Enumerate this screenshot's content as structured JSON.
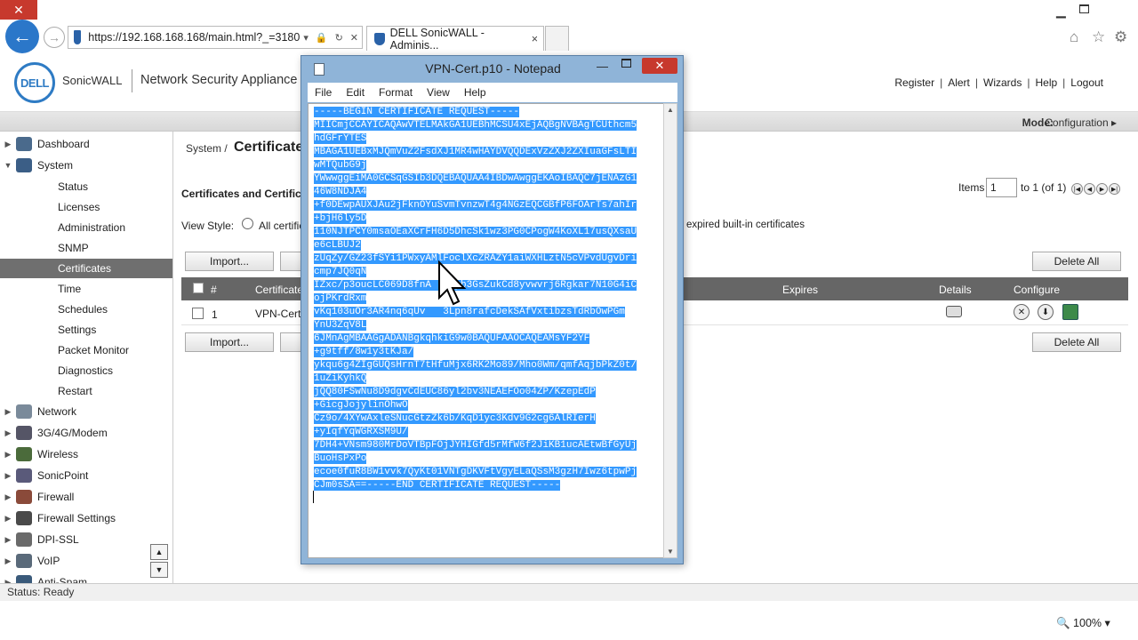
{
  "browser": {
    "url": "https://192.168.168.168/main.html?_=3180",
    "tab_title": "DELL SonicWALL - Adminis...",
    "tab_close": "×",
    "zoom": "100%"
  },
  "header": {
    "logo_text": "DELL",
    "brand": "SonicWALL",
    "product": "Network Security Appliance",
    "links": [
      "Register",
      "Alert",
      "Wizards",
      "Help",
      "Logout"
    ],
    "mode_label": "Mode:",
    "mode_value": "Configuration ▸"
  },
  "sidebar": {
    "items": [
      {
        "label": "Dashboard",
        "type": "top",
        "arrow": "▶"
      },
      {
        "label": "System",
        "type": "top",
        "arrow": "▼"
      },
      {
        "label": "Status",
        "type": "sub"
      },
      {
        "label": "Licenses",
        "type": "sub"
      },
      {
        "label": "Administration",
        "type": "sub"
      },
      {
        "label": "SNMP",
        "type": "sub"
      },
      {
        "label": "Certificates",
        "type": "sub",
        "active": true
      },
      {
        "label": "Time",
        "type": "sub"
      },
      {
        "label": "Schedules",
        "type": "sub"
      },
      {
        "label": "Settings",
        "type": "sub"
      },
      {
        "label": "Packet Monitor",
        "type": "sub"
      },
      {
        "label": "Diagnostics",
        "type": "sub"
      },
      {
        "label": "Restart",
        "type": "sub"
      },
      {
        "label": "Network",
        "type": "top",
        "arrow": "▶"
      },
      {
        "label": "3G/4G/Modem",
        "type": "top",
        "arrow": "▶"
      },
      {
        "label": "Wireless",
        "type": "top",
        "arrow": "▶"
      },
      {
        "label": "SonicPoint",
        "type": "top",
        "arrow": "▶"
      },
      {
        "label": "Firewall",
        "type": "top",
        "arrow": "▶"
      },
      {
        "label": "Firewall Settings",
        "type": "top",
        "arrow": "▶"
      },
      {
        "label": "DPI-SSL",
        "type": "top",
        "arrow": "▶"
      },
      {
        "label": "VoIP",
        "type": "top",
        "arrow": "▶"
      },
      {
        "label": "Anti-Spam",
        "type": "top",
        "arrow": "▶"
      }
    ]
  },
  "main": {
    "breadcrumb": "System /",
    "page_title": "Certificate",
    "section_title": "Certificates and Certifica",
    "view_style_label": "View Style:",
    "radio_all_label": "All certific",
    "expired_label": "expired built-in certificates",
    "items_label": "Items",
    "items_value": "1",
    "items_range": "to 1 (of 1)",
    "import_label": "Import...",
    "delete_all_label": "Delete All",
    "table": {
      "headers": {
        "num": "#",
        "cert": "Certificate",
        "expires": "Expires",
        "details": "Details",
        "configure": "Configure"
      },
      "rows": [
        {
          "num": "1",
          "name": "VPN-Cert"
        }
      ]
    }
  },
  "status": {
    "text": "Status: Ready"
  },
  "notepad": {
    "title": "VPN-Cert.p10 - Notepad",
    "menu": [
      "File",
      "Edit",
      "Format",
      "View",
      "Help"
    ],
    "lines": [
      "-----BEGIN CERTIFICATE REQUEST-----",
      "MIICmjCCAYICAQAwVTELMAkGA1UEBhMCSU4xEjAQBgNVBAgTCUthcm5",
      "hdGFrYTES",
      "MBAGA1UEBxMJQmVuZ2FsdXJ1MR4wHAYDVQQDExVzZXJ2ZXIuaGFsLTI",
      "wMTQubG9j",
      "YWwwggEiMA0GCSqGSIb3DQEBAQUAA4IBDwAwggEKAoIBAQC7jENAzG1",
      "46W8NDJA4",
      "+f0DEwpAUXJAu2jFknOYuSvmTvnzwT4g4NGzEQCGBfP6FOArTs7ahIr",
      "+bjH6ly5D",
      "110NJTPCY0msaOEaXCrFH6D5DhcSk1wz3PG0CPogW4KoXL17usQXsaU",
      "e6cLBUJ2",
      "zUqZy/GZ23fSYi1PWxyAMlFoclXcZRAZY1aiWXHLztN5cVPvdUgvDri",
      "cmp7JQ0qN",
      "IZxc/p3oucLC069D8fnA   fyb3GsZukCd8yvwvrj6Rgkar7N10G4iC",
      "ojPKrdRxm",
      "vKq103uOr3AR4nq6qUv   3Lpn8rafcDekSAfVxtibzsTdRbOwPGm",
      "YnU3ZqV8L",
      "6JMnAgMBAAGgADANBgkqhkiG9w0BAQUFAAOCAQEAMsYF2YF",
      "+g9tff/8w1y3tKJa/",
      "ykqu6g4ZIgGUQsHrnT7tHfuMjx6RK2Mo89/Mho0Wm/qmfAqjbPkZ0t/",
      "1uZiKyhkQ",
      "jQQ80FSwNu8D9dgvCdEUC86yl2bv3NEAEFOo04ZP/KzepEdP",
      "+GicgJojylinOhwO",
      "Cz9o/4XYwAxleSNucGtzZk6b/KqD1yc3Kdv9G2cg6AlRIerH",
      "+yIqfYqWGRXSM9U/",
      "7DH4+VNsm980MrDoVTBpFOjJYHIGfd5rMfW6f2JiKB1ucAEtwBfGyUj",
      "BuoHsPxPo",
      "ecoe0fuR8BW1vvk7QyKt01VNTgDKVFtVgyELaQSsM3gzH7Iwz6tpwPj",
      "CJm0sSA==-----END CERTIFICATE REQUEST-----"
    ]
  },
  "colors": {
    "dell_blue": "#2e7bc4",
    "selection": "#3399ff",
    "close_red": "#c7392d"
  }
}
